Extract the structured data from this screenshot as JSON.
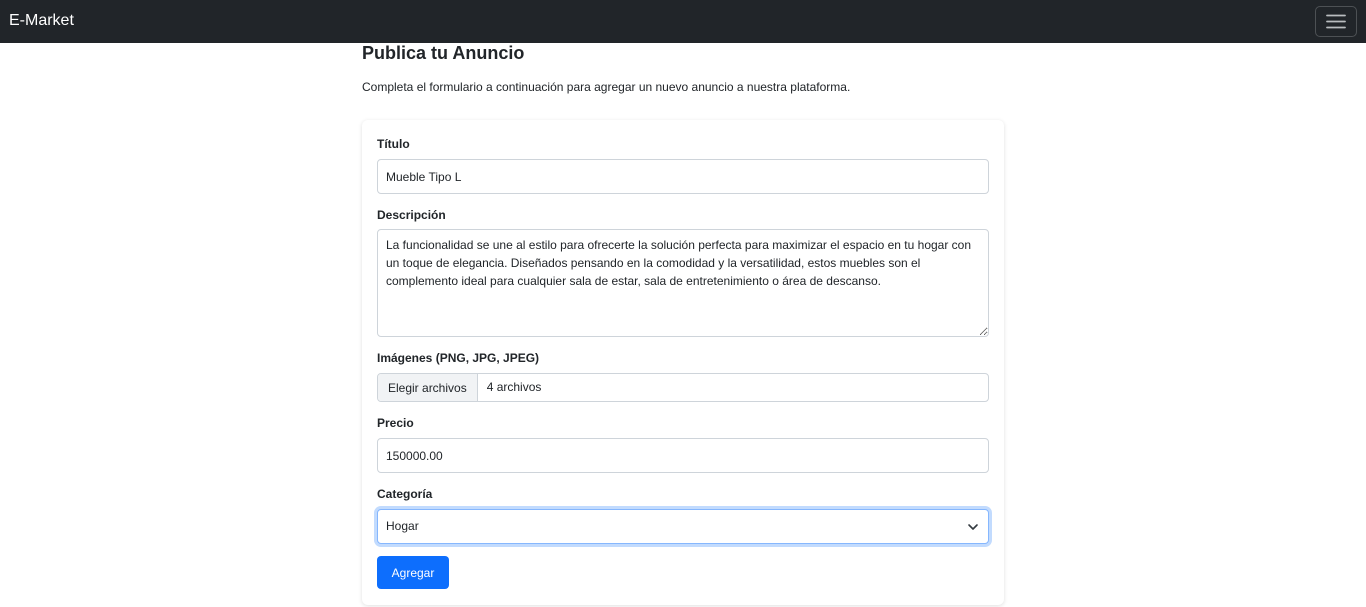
{
  "navbar": {
    "brand": "E-Market",
    "toggler_icon": "hamburger-menu-icon"
  },
  "header": {
    "title": "Publica tu Anuncio",
    "description": "Completa el formulario a continuación para agregar un nuevo anuncio a nuestra plataforma."
  },
  "form": {
    "title": {
      "label": "Título",
      "value": "Mueble Tipo L"
    },
    "description": {
      "label": "Descripción",
      "value": "La funcionalidad se une al estilo para ofrecerte la solución perfecta para maximizar el espacio en tu hogar con un toque de elegancia. Diseñados pensando en la comodidad y la versatilidad, estos muebles son el complemento ideal para cualquier sala de estar, sala de entretenimiento o área de descanso."
    },
    "images": {
      "label": "Imágenes (PNG, JPG, JPEG)",
      "button_label": "Elegir archivos",
      "file_status": "4 archivos"
    },
    "price": {
      "label": "Precio",
      "value": "150000.00"
    },
    "category": {
      "label": "Categoría",
      "selected": "Hogar"
    },
    "submit_label": "Agregar"
  },
  "colors": {
    "navbar_bg": "#212529",
    "primary": "#0d6efd",
    "focus_border": "#86b7fe",
    "input_border": "#ced4da"
  }
}
